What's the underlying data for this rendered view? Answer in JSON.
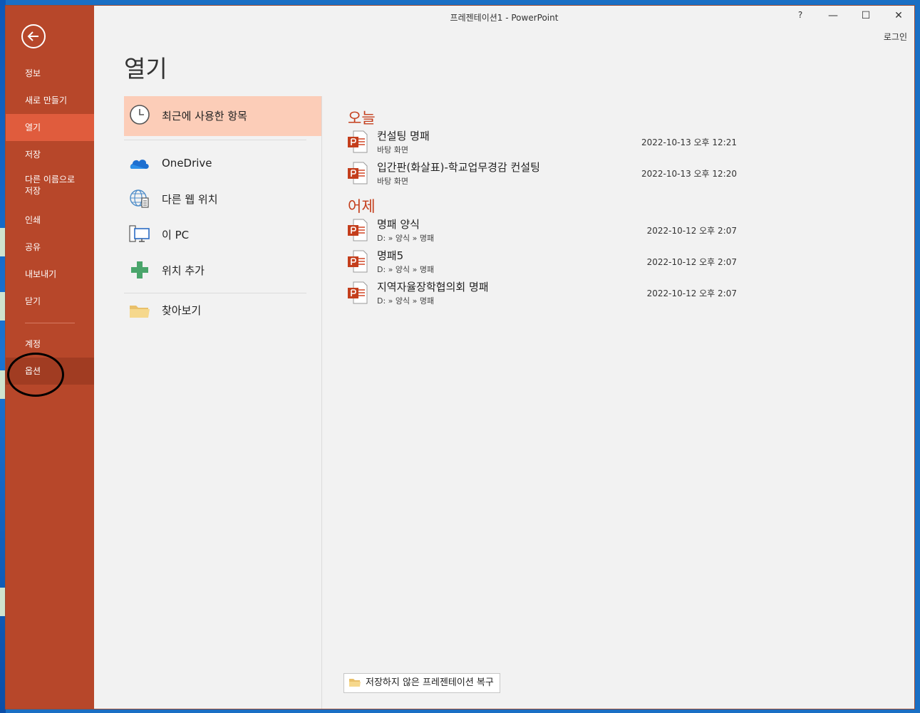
{
  "window": {
    "title": "프레젠테이션1 - PowerPoint",
    "help": "?",
    "minimize": "—",
    "maximize": "☐",
    "close": "✕",
    "login": "로그인"
  },
  "nav": {
    "back_icon": "back-arrow-icon",
    "items": [
      {
        "label": "정보"
      },
      {
        "label": "새로 만들기"
      },
      {
        "label": "열기",
        "selected": true
      },
      {
        "label": "저장"
      },
      {
        "label": "다른 이름으로 저장"
      },
      {
        "label": "인쇄"
      },
      {
        "label": "공유"
      },
      {
        "label": "내보내기"
      },
      {
        "label": "닫기"
      },
      {
        "label": "계정"
      },
      {
        "label": "옵션"
      }
    ]
  },
  "main": {
    "heading": "열기",
    "locations": [
      {
        "label": "최근에 사용한 항목",
        "icon": "clock-icon",
        "selected": true
      },
      {
        "label": "OneDrive",
        "icon": "cloud-icon"
      },
      {
        "label": "다른 웹 위치",
        "icon": "globe-icon"
      },
      {
        "label": "이 PC",
        "icon": "computer-icon"
      },
      {
        "label": "위치 추가",
        "icon": "plus-icon"
      },
      {
        "label": "찾아보기",
        "icon": "folder-icon"
      }
    ],
    "groups": [
      {
        "label": "오늘",
        "files": [
          {
            "name": "컨설팅 명패",
            "path": "바탕 화면",
            "date": "2022-10-13 오후 12:21"
          },
          {
            "name": "입간판(화살표)-학교업무경감 컨설팅",
            "path": "바탕 화면",
            "date": "2022-10-13 오후 12:20"
          }
        ]
      },
      {
        "label": "어제",
        "files": [
          {
            "name": "명패 양식",
            "path": "D: » 양식 » 명패",
            "date": "2022-10-12 오후 2:07"
          },
          {
            "name": "명패5",
            "path": "D: » 양식 » 명패",
            "date": "2022-10-12 오후 2:07"
          },
          {
            "name": "지역자율장학협의회 명패",
            "path": "D: » 양식 » 명패",
            "date": "2022-10-12 오후 2:07"
          }
        ]
      }
    ],
    "recover_button": "저장하지 않은 프레젠테이션 복구"
  },
  "colors": {
    "nav_bg": "#b7472a",
    "nav_selected": "#e05c3d",
    "accent": "#c43e1c",
    "selected_location": "#fccdb8"
  }
}
